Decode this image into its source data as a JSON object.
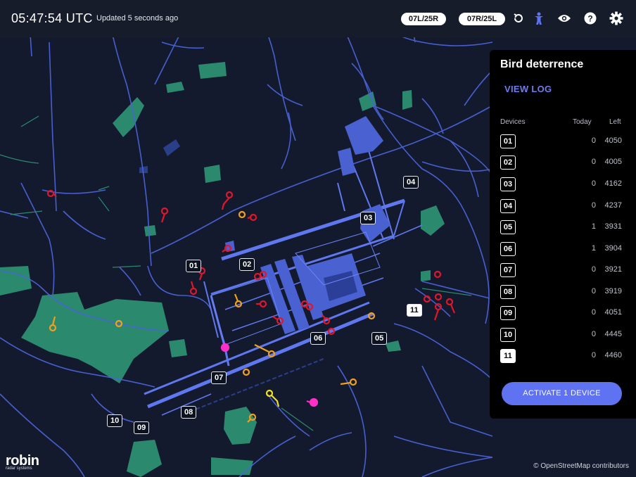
{
  "header": {
    "time": "05:47:54 UTC",
    "updated": "Updated 5 seconds ago",
    "runways": [
      "07L/25R",
      "07R/25L"
    ],
    "icons": [
      "history-icon",
      "person-icon",
      "eye-icon",
      "help-icon",
      "gear-icon"
    ]
  },
  "panel": {
    "title": "Bird deterrence",
    "view_log": "VIEW LOG",
    "col_devices": "Devices",
    "col_today": "Today",
    "col_left": "Left",
    "devices": [
      {
        "id": "01",
        "today": "0",
        "left": "4050"
      },
      {
        "id": "02",
        "today": "0",
        "left": "4005"
      },
      {
        "id": "03",
        "today": "0",
        "left": "4162"
      },
      {
        "id": "04",
        "today": "0",
        "left": "4237"
      },
      {
        "id": "05",
        "today": "1",
        "left": "3931"
      },
      {
        "id": "06",
        "today": "1",
        "left": "3904"
      },
      {
        "id": "07",
        "today": "0",
        "left": "3921"
      },
      {
        "id": "08",
        "today": "0",
        "left": "3919"
      },
      {
        "id": "09",
        "today": "0",
        "left": "4051"
      },
      {
        "id": "10",
        "today": "0",
        "left": "4445"
      },
      {
        "id": "11",
        "today": "0",
        "left": "4460"
      }
    ],
    "activate": "ACTIVATE 1 DEVICE"
  },
  "map": {
    "device_labels": [
      "01",
      "02",
      "03",
      "04",
      "05",
      "06",
      "07",
      "08",
      "09",
      "10",
      "11"
    ],
    "selected_device": "11"
  },
  "logo": {
    "word": "robin",
    "sub": "radar systems"
  },
  "attribution": "© OpenStreetMap contributors",
  "colors": {
    "background": "#141a2e",
    "roads": "#4a63d8",
    "green": "#2b8a6e",
    "accent": "#5f72f2",
    "track_red": "#e0162b",
    "track_orange": "#f0a020",
    "track_yellow": "#f2e21a",
    "track_magenta": "#ff2fc8"
  }
}
